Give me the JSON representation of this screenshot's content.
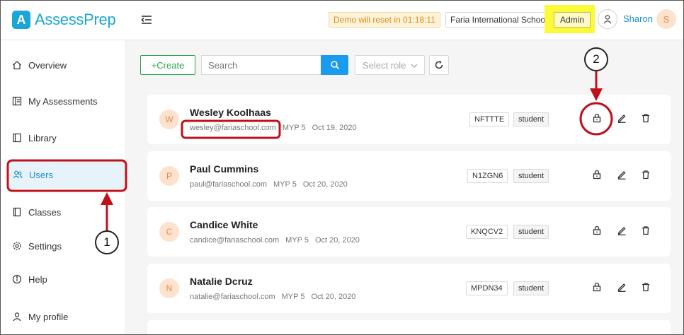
{
  "header": {
    "logo_letter": "A",
    "logo_text": "AssessPrep",
    "demo_notice": "Demo will reset in 01:18:11",
    "school": "Faria International School",
    "role": "Admin",
    "user_name": "Sharon",
    "user_initial": "S"
  },
  "sidebar": {
    "items": [
      {
        "label": "Overview",
        "icon": "home-icon"
      },
      {
        "label": "My Assessments",
        "icon": "assessments-icon"
      },
      {
        "label": "Library",
        "icon": "library-icon"
      },
      {
        "label": "Users",
        "icon": "users-icon",
        "active": true
      },
      {
        "label": "Classes",
        "icon": "classes-icon"
      },
      {
        "label": "Settings",
        "icon": "settings-icon"
      },
      {
        "label": "Help",
        "icon": "help-icon"
      },
      {
        "label": "My profile",
        "icon": "profile-icon"
      }
    ]
  },
  "toolbar": {
    "create_label": "+Create",
    "search_placeholder": "Search",
    "select_role_placeholder": "Select role"
  },
  "users": [
    {
      "initial": "W",
      "name": "Wesley Koolhaas",
      "email": "wesley@fariaschool.com",
      "grade": "MYP 5",
      "date": "Oct 19, 2020",
      "code": "NFTTTE",
      "role": "student"
    },
    {
      "initial": "P",
      "name": "Paul Cummins",
      "email": "paul@fariaschool.com",
      "grade": "MYP 5",
      "date": "Oct 20, 2020",
      "code": "N1ZGN6",
      "role": "student"
    },
    {
      "initial": "C",
      "name": "Candice White",
      "email": "candice@fariaschool.com",
      "grade": "MYP 5",
      "date": "Oct 20, 2020",
      "code": "KNQCV2",
      "role": "student"
    },
    {
      "initial": "N",
      "name": "Natalie Dcruz",
      "email": "natalie@fariaschool.com",
      "grade": "MYP 5",
      "date": "Oct 20, 2020",
      "code": "MPDN34",
      "role": "student"
    }
  ],
  "annotations": {
    "callout_1": "1",
    "callout_2": "2",
    "highlight_color": "#c0101a"
  },
  "colors": {
    "brand": "#1aa6d6",
    "create": "#2da44e",
    "search_button": "#1a9bf0",
    "avatar_bg": "#fde2cd",
    "active_nav_bg": "#e7f3fb"
  }
}
